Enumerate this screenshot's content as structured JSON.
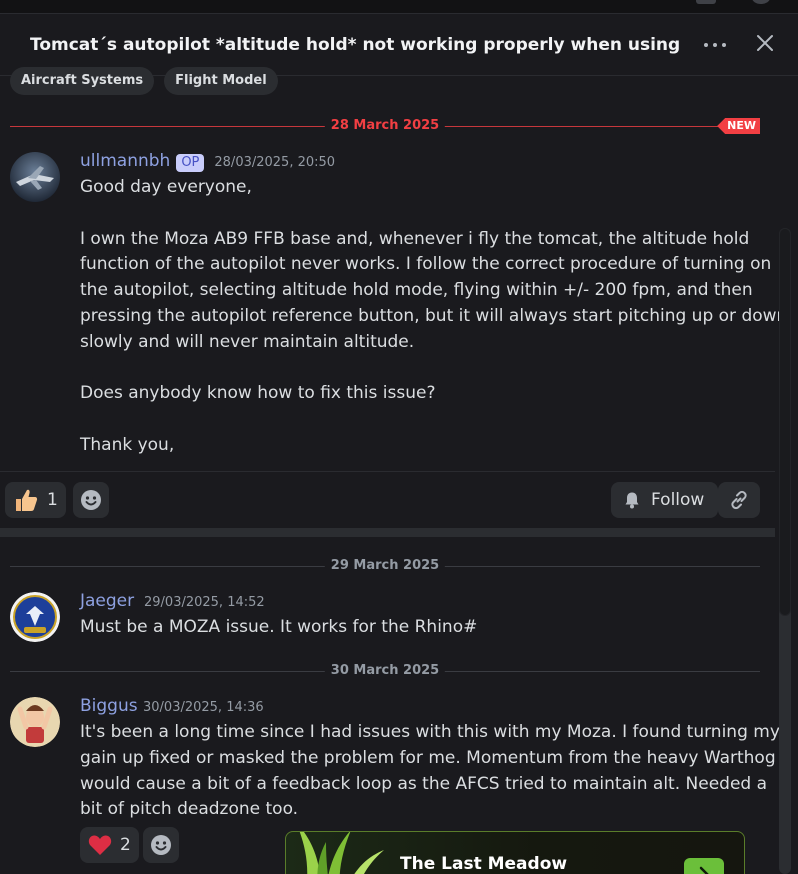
{
  "thread": {
    "title": "Tomcat´s autopilot *altitude hold* not working properly when using force fee",
    "tags": [
      "Aircraft Systems",
      "Flight Model"
    ]
  },
  "icons": {
    "more": "more-horizontal-icon",
    "close": "close-icon",
    "thumbs_up": "thumbs-up-emoji",
    "add_reaction": "add-reaction-icon",
    "bell": "bell-icon",
    "link": "link-icon",
    "heart": "heart-emoji"
  },
  "colors": {
    "accent": "#f23f43",
    "author": "#8ea1e1",
    "op_badge": "#c9cdfb"
  },
  "dividers": {
    "first": "28 March 2025",
    "first_badge": "NEW",
    "second": "29 March 2025",
    "third": "30 March 2025"
  },
  "messages": [
    {
      "author": "ullmannbh",
      "badge": "OP",
      "timestamp": "28/03/2025, 20:50",
      "lines": [
        "Good day everyone,",
        "",
        "I own the Moza AB9 FFB base and, whenever i fly the tomcat, the altitude hold",
        "function of the autopilot never works. I follow the correct procedure of turning on",
        "the autopilot, selecting altitude hold mode, flying within +/- 200 fpm, and then",
        "pressing the autopilot reference button, but it will always start pitching up or down",
        "slowly and will never maintain altitude.",
        "",
        "Does anybody know how to fix this issue?",
        "",
        "Thank you,"
      ],
      "reaction_count": "1",
      "follow_label": "Follow"
    },
    {
      "author": "Jaeger",
      "timestamp": "29/03/2025, 14:52",
      "lines": [
        "Must be a MOZA issue. It works for the Rhino#"
      ]
    },
    {
      "author": "Biggus",
      "timestamp": "30/03/2025, 14:36",
      "lines": [
        "It's been a long time since I had issues with this with my Moza.  I found turning my",
        "gain up fixed or masked the problem for me.  Momentum from the heavy Warthog",
        "would cause a bit of a feedback loop as the AFCS tried to maintain alt.  Needed a",
        "bit of pitch deadzone too."
      ],
      "reaction_count": "2"
    }
  ],
  "promo": {
    "title": "The Last Meadow"
  }
}
